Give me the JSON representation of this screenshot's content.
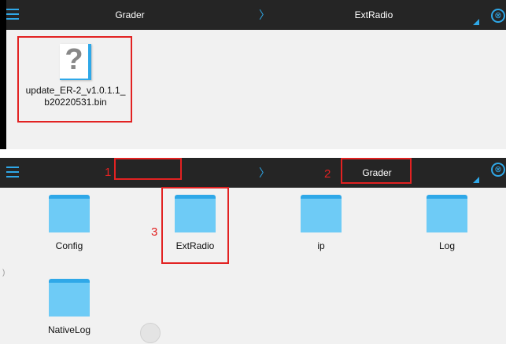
{
  "screen1": {
    "header": {
      "left_crumb": "Grader",
      "separator": "〉",
      "right_crumb": "ExtRadio",
      "close_glyph": "⊗"
    },
    "files": [
      {
        "line1": "update_ER-2_v1.0.1.1_",
        "line2": "b20220531.bin",
        "icon": "unknown-file-icon",
        "icon_glyph": "?"
      }
    ]
  },
  "screen2": {
    "header": {
      "left_crumb": "",
      "separator": "〉",
      "right_crumb": "Grader",
      "close_glyph": "⊗"
    },
    "folders": [
      {
        "name": "Config"
      },
      {
        "name": "ExtRadio"
      },
      {
        "name": "ip"
      },
      {
        "name": "Log"
      },
      {
        "name": "NativeLog"
      }
    ],
    "annotations": [
      "1",
      "2",
      "3"
    ],
    "edge_glyph": ")"
  },
  "colors": {
    "accent": "#2fa8e8",
    "folder_fill": "#6ecbf6",
    "topbar_bg": "#252525",
    "content_bg": "#f1f1f1",
    "annotation": "#e22222"
  }
}
